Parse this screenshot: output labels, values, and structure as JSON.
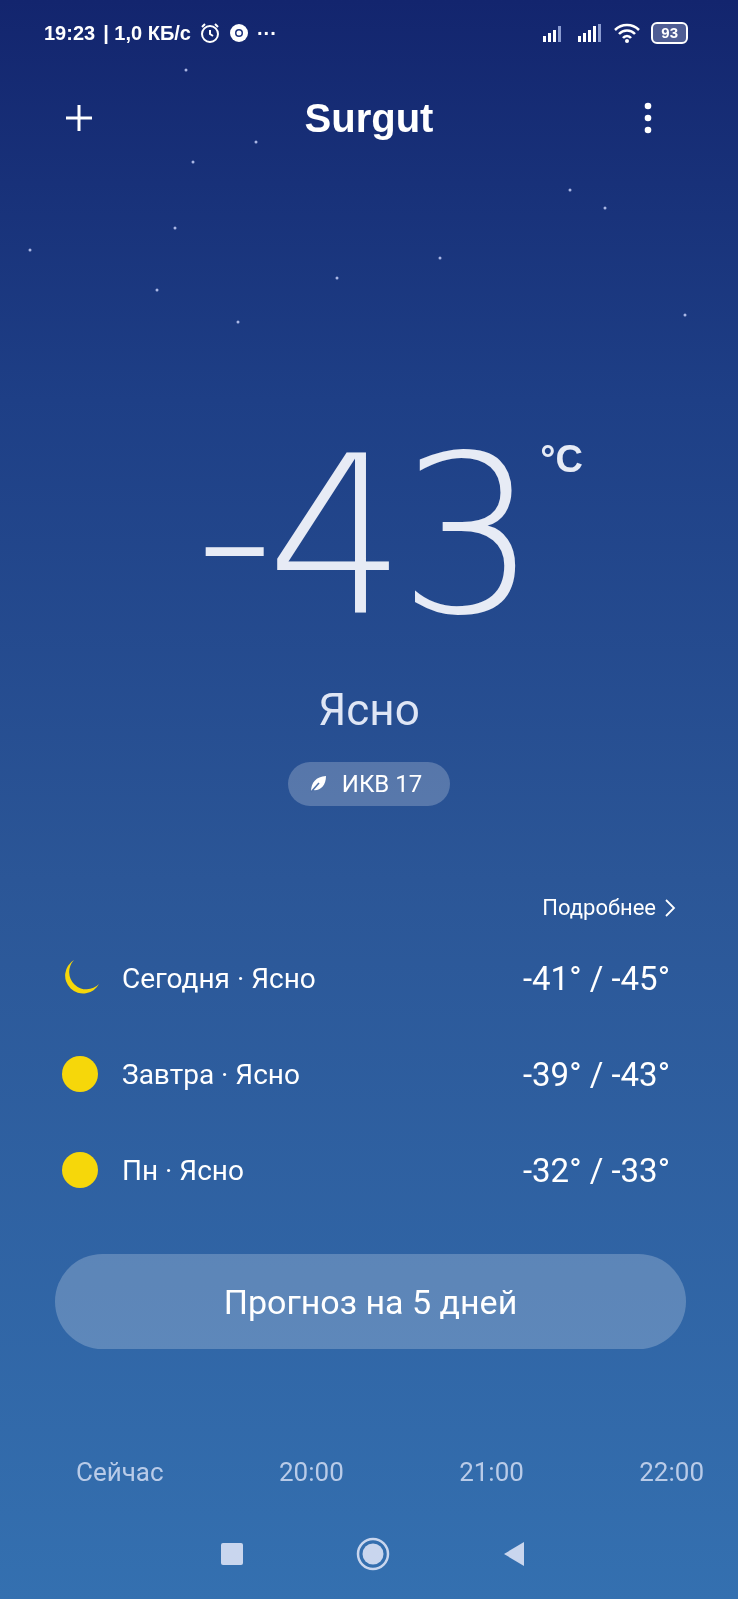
{
  "status_bar": {
    "time": "19:23",
    "speed": "| 1,0 КБ/с",
    "dots": "···",
    "battery": "93"
  },
  "header": {
    "title": "Surgut"
  },
  "current": {
    "temperature": "-43",
    "unit": "°C",
    "condition": "Ясно",
    "aqi": "ИКВ 17"
  },
  "details_link": "Подробнее",
  "days": [
    {
      "kind": "moon",
      "label": "Сегодня · Ясно",
      "temps": "-41° / -45°"
    },
    {
      "kind": "sun",
      "label": "Завтра · Ясно",
      "temps": "-39° / -43°"
    },
    {
      "kind": "sun",
      "label": "Пн · Ясно",
      "temps": "-32° / -33°"
    }
  ],
  "forecast_button": "Прогноз на 5 дней",
  "hours": [
    "Сейчас",
    "20:00",
    "21:00",
    "22:00"
  ]
}
